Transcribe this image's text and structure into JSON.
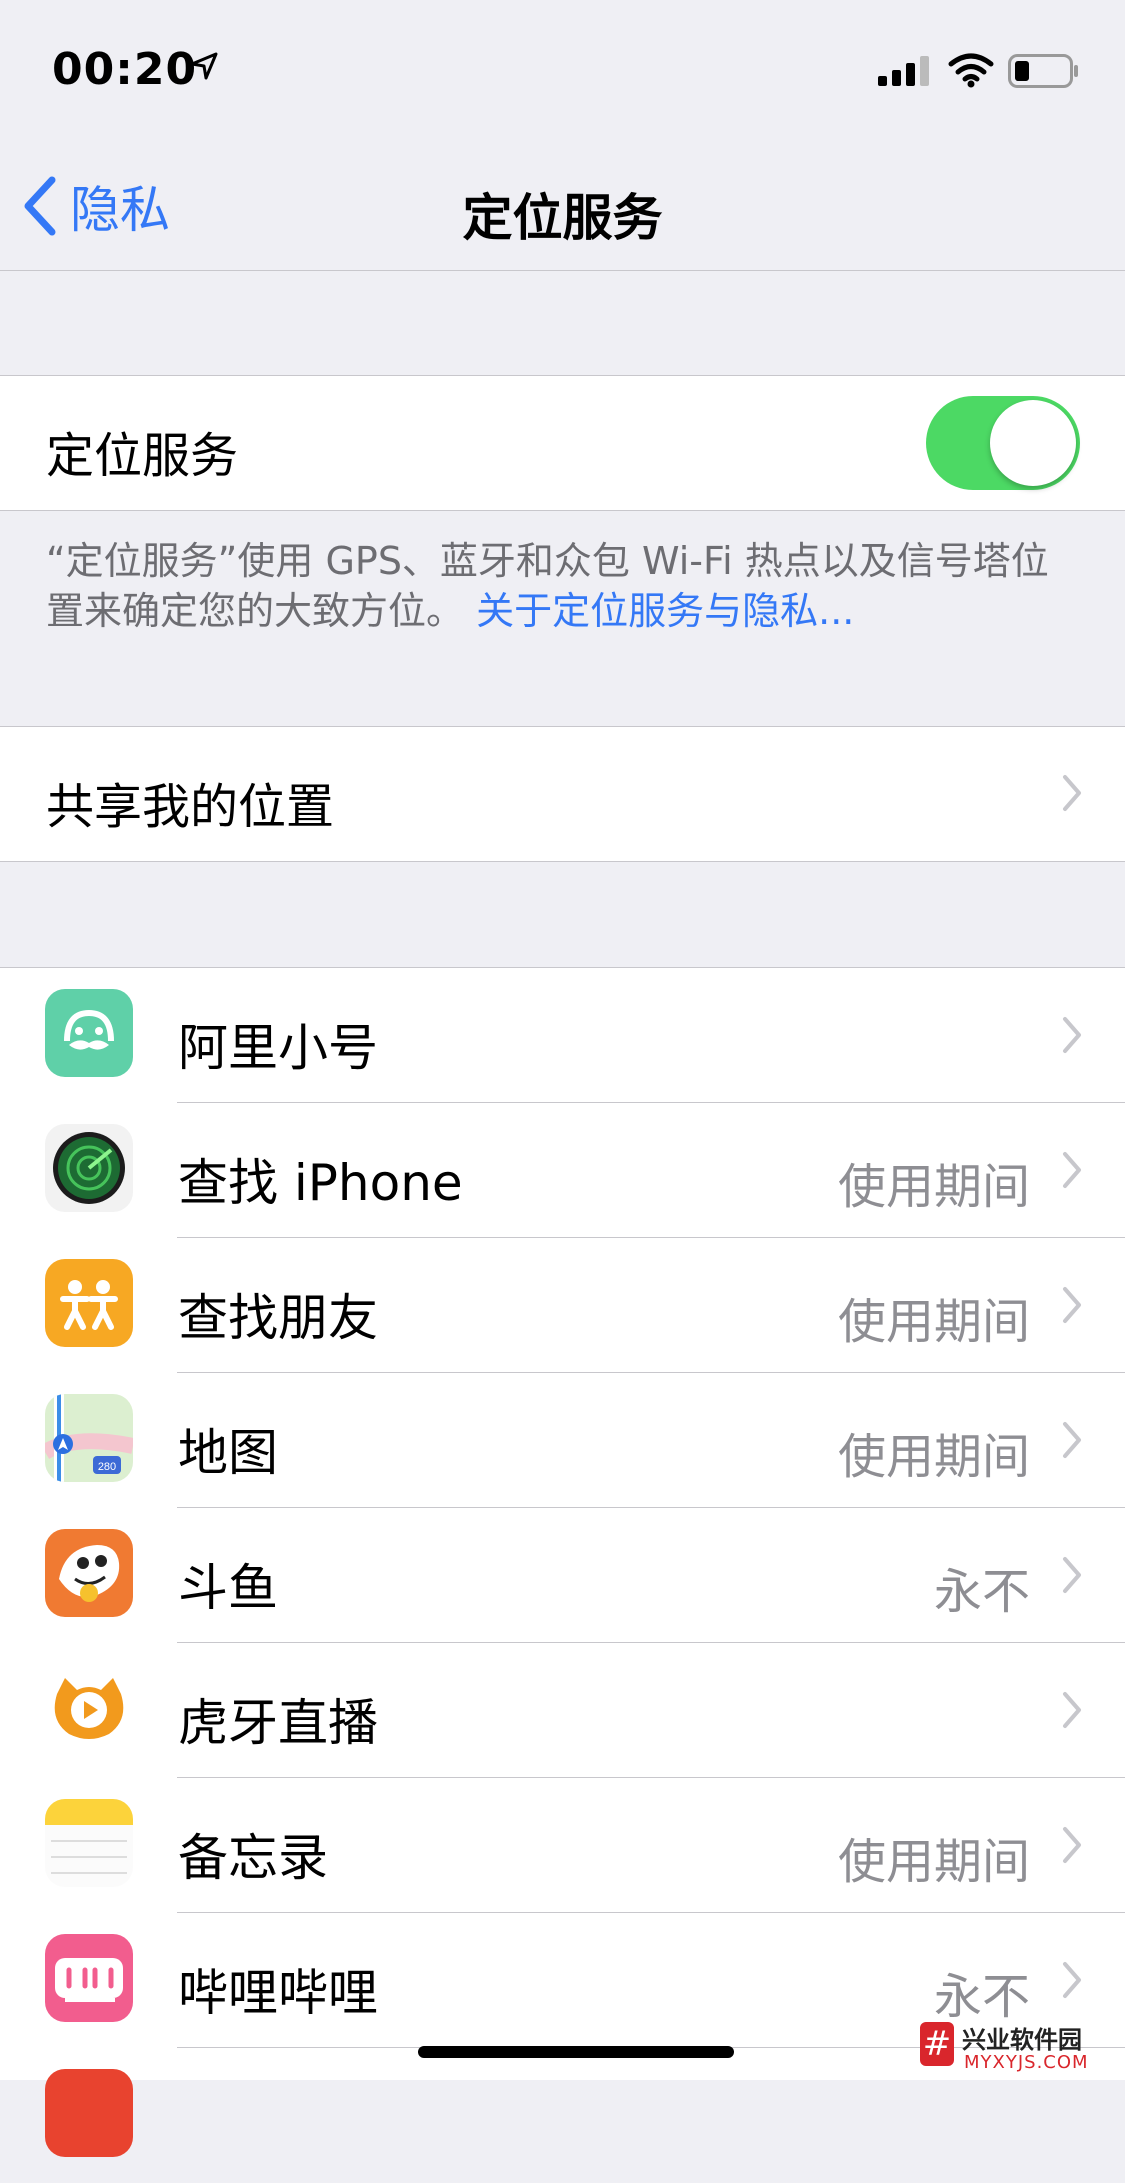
{
  "status_bar": {
    "time": "00:20"
  },
  "nav": {
    "back_label": "隐私",
    "title": "定位服务"
  },
  "location_services": {
    "label": "定位服务",
    "enabled": true,
    "toggle_color": "#4cd964"
  },
  "note": {
    "text": "“定位服务”使用 GPS、蓝牙和众包 Wi-Fi 热点以及信号塔位置来确定您的大致方位。",
    "link": "关于定位服务与隐私..."
  },
  "share_location": {
    "label": "共享我的位置"
  },
  "apps": [
    {
      "name": "阿里小号",
      "value": "",
      "icon": "ali-xiaohao-icon"
    },
    {
      "name": "查找 iPhone",
      "value": "使用期间",
      "icon": "find-iphone-icon"
    },
    {
      "name": "查找朋友",
      "value": "使用期间",
      "icon": "find-friends-icon"
    },
    {
      "name": "地图",
      "value": "使用期间",
      "icon": "maps-icon"
    },
    {
      "name": "斗鱼",
      "value": "永不",
      "icon": "douyu-icon"
    },
    {
      "name": "虎牙直播",
      "value": "",
      "icon": "huya-icon"
    },
    {
      "name": "备忘录",
      "value": "使用期间",
      "icon": "notes-icon"
    },
    {
      "name": "哔哩哔哩",
      "value": "永不",
      "icon": "bilibili-icon"
    }
  ],
  "watermark": {
    "main": "兴业软件园",
    "sub": "MYXYJS.COM"
  },
  "colors": {
    "accent": "#3478f6",
    "background": "#efeff4",
    "secondary_text": "#8e8e93"
  }
}
